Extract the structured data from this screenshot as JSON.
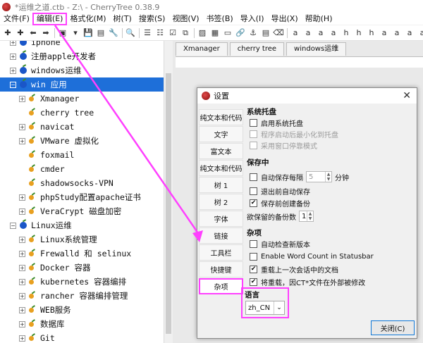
{
  "window": {
    "title": "*运维之道.ctb - Z:\\ - CherryTree 0.38.9"
  },
  "menubar": [
    {
      "label": "文件(F)"
    },
    {
      "label": "编辑(E)"
    },
    {
      "label": "格式化(M)"
    },
    {
      "label": "树(T)"
    },
    {
      "label": "搜索(S)"
    },
    {
      "label": "视图(V)"
    },
    {
      "label": "书签(B)"
    },
    {
      "label": "导入(I)"
    },
    {
      "label": "导出(X)"
    },
    {
      "label": "帮助(H)"
    }
  ],
  "toolbar": {
    "icons": [
      "add-node-icon",
      "add-subnode-icon",
      "undo-icon",
      "redo-icon",
      "open-icon",
      "dropdown-icon",
      "save-icon",
      "export-pdf-icon",
      "preferences-icon",
      "search-icon",
      "bulleted-list-icon",
      "numbered-list-icon",
      "todo-list-icon",
      "copy-icon",
      "image-icon",
      "table-icon",
      "codebox-icon",
      "link-icon",
      "anchor-icon",
      "toc-icon",
      "clear-format-icon",
      "bold-icon",
      "italic-icon",
      "underline-icon",
      "strikethrough-icon",
      "h1-icon",
      "h2-icon",
      "h3-icon",
      "small-icon",
      "superscript-icon",
      "subscript-icon",
      "monospace-icon"
    ],
    "glyphs": [
      "✚",
      "✚",
      "⬅",
      "➡",
      "▣",
      "▾",
      "💾",
      "▤",
      "🔧",
      "🔍",
      "☰",
      "☷",
      "☑",
      "⧉",
      "▨",
      "▦",
      "▭",
      "🔗",
      "⚓",
      "▤",
      "⌫",
      "a",
      "a",
      "a",
      "a",
      "h",
      "h",
      "h",
      "a",
      "a",
      "a",
      "a"
    ]
  },
  "tree": {
    "nodes": [
      {
        "label": "iphone",
        "level": 0,
        "type": "bullet",
        "expander": "+"
      },
      {
        "label": "注册apple开发者",
        "level": 0,
        "type": "bullet",
        "expander": "+"
      },
      {
        "label": "windows运维",
        "level": 0,
        "type": "bullet",
        "expander": "+"
      },
      {
        "label": "win 应用",
        "level": 0,
        "type": "bullet",
        "expander": "−",
        "selected": true
      },
      {
        "label": "Xmanager",
        "level": 1,
        "type": "leaf",
        "expander": "+"
      },
      {
        "label": "cherry tree",
        "level": 1,
        "type": "leaf",
        "expander": ""
      },
      {
        "label": "navicat",
        "level": 1,
        "type": "leaf",
        "expander": "+"
      },
      {
        "label": "VMware 虚拟化",
        "level": 1,
        "type": "leaf",
        "expander": "+"
      },
      {
        "label": "foxmail",
        "level": 1,
        "type": "leaf",
        "expander": ""
      },
      {
        "label": "cmder",
        "level": 1,
        "type": "leaf",
        "expander": ""
      },
      {
        "label": "shadowsocks-VPN",
        "level": 1,
        "type": "leaf",
        "expander": ""
      },
      {
        "label": "phpStudy配置apache证书",
        "level": 1,
        "type": "leaf",
        "expander": "+"
      },
      {
        "label": "VeraCrypt 磁盘加密",
        "level": 1,
        "type": "leaf",
        "expander": "+"
      },
      {
        "label": "Linux运维",
        "level": 0,
        "type": "bullet",
        "expander": "−"
      },
      {
        "label": "Linux系统管理",
        "level": 1,
        "type": "leaf",
        "expander": "+"
      },
      {
        "label": "Frewalld 和 selinux",
        "level": 1,
        "type": "leaf",
        "expander": "+"
      },
      {
        "label": "Docker 容器",
        "level": 1,
        "type": "leaf",
        "expander": "+"
      },
      {
        "label": "kubernetes 容器编排",
        "level": 1,
        "type": "leaf",
        "expander": "+"
      },
      {
        "label": "rancher 容器编排管理",
        "level": 1,
        "type": "leaf",
        "expander": "+"
      },
      {
        "label": "WEB服务",
        "level": 1,
        "type": "leaf",
        "expander": "+"
      },
      {
        "label": "数据库",
        "level": 1,
        "type": "leaf",
        "expander": "+"
      },
      {
        "label": "Git",
        "level": 1,
        "type": "leaf",
        "expander": "+"
      }
    ]
  },
  "tabs": [
    {
      "label": "Xmanager"
    },
    {
      "label": "cherry tree"
    },
    {
      "label": "windows运维"
    }
  ],
  "dialog": {
    "title": "设置",
    "close_glyph": "✕",
    "sidebar": [
      {
        "label": "纯文本和代码"
      },
      {
        "label": "文字"
      },
      {
        "label": "富文本"
      },
      {
        "label": "纯文本和代码"
      },
      {
        "label": "树 1"
      },
      {
        "label": "树 2"
      },
      {
        "label": "字体"
      },
      {
        "label": "链接"
      },
      {
        "label": "工具栏"
      },
      {
        "label": "快捷键"
      },
      {
        "label": "杂项",
        "active": true
      }
    ],
    "tray": {
      "header": "系统托盘",
      "enable_tray": {
        "label": "启用系统托盘",
        "checked": false
      },
      "start_minimized": {
        "label": "程序启动后最小化到托盘",
        "checked": false
      },
      "use_window_mode": {
        "label": "采用窗口停靠模式",
        "checked": false
      }
    },
    "saving": {
      "header": "保存中",
      "autosave": {
        "label": "自动保存每隔",
        "checked": false,
        "value": "5",
        "unit": "分钟"
      },
      "autosave_on_quit": {
        "label": "退出前自动保存",
        "checked": false
      },
      "backup_before_save": {
        "label": "保存前创建备份",
        "checked": true
      },
      "num_backups": {
        "label": "欲保留的备份数",
        "value": "1"
      }
    },
    "misc": {
      "header": "杂项",
      "check_version": {
        "label": "自动检查新版本",
        "checked": false
      },
      "word_count": {
        "label": "Enable Word Count in Statusbar",
        "checked": false
      },
      "reload_last_doc": {
        "label": "重载上一次会话中的文档",
        "checked": true
      },
      "reload_on_modify": {
        "label": "将重载，因CT*文件在外部被修改",
        "checked": true
      }
    },
    "language": {
      "header": "语言",
      "selected": "zh_CN"
    },
    "close_button": "关闭(C)"
  },
  "colors": {
    "highlight": "#ff40ff",
    "selection": "#1e6fd9",
    "node_bullet": "#1a56c8"
  }
}
